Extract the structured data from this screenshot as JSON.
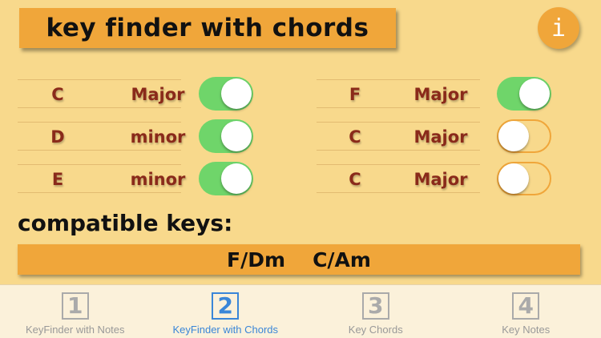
{
  "header": {
    "title": "key finder with chords",
    "info_label": "i"
  },
  "left_rows": [
    {
      "note": "C",
      "mode": "Major",
      "toggle_on": true
    },
    {
      "note": "D",
      "mode": "minor",
      "toggle_on": true
    },
    {
      "note": "E",
      "mode": "minor",
      "toggle_on": true
    }
  ],
  "right_rows": [
    {
      "note": "F",
      "mode": "Major",
      "toggle_on": true
    },
    {
      "note": "C",
      "mode": "Major",
      "toggle_on": false
    },
    {
      "note": "C",
      "mode": "Major",
      "toggle_on": false
    }
  ],
  "compatible": {
    "label": "compatible keys:",
    "keys": [
      "F/Dm",
      "C/Am"
    ]
  },
  "tabs": [
    {
      "number": "1",
      "label": "KeyFinder with Notes",
      "active": false
    },
    {
      "number": "2",
      "label": "KeyFinder with Chords",
      "active": true
    },
    {
      "number": "3",
      "label": "Key Chords",
      "active": false
    },
    {
      "number": "4",
      "label": "Key Notes",
      "active": false
    }
  ],
  "colors": {
    "background": "#f8d98c",
    "accent": "#f0a63a",
    "toggle_on": "#6fd56a",
    "note_text": "#8a2a1a",
    "tab_active": "#3a86d8"
  }
}
